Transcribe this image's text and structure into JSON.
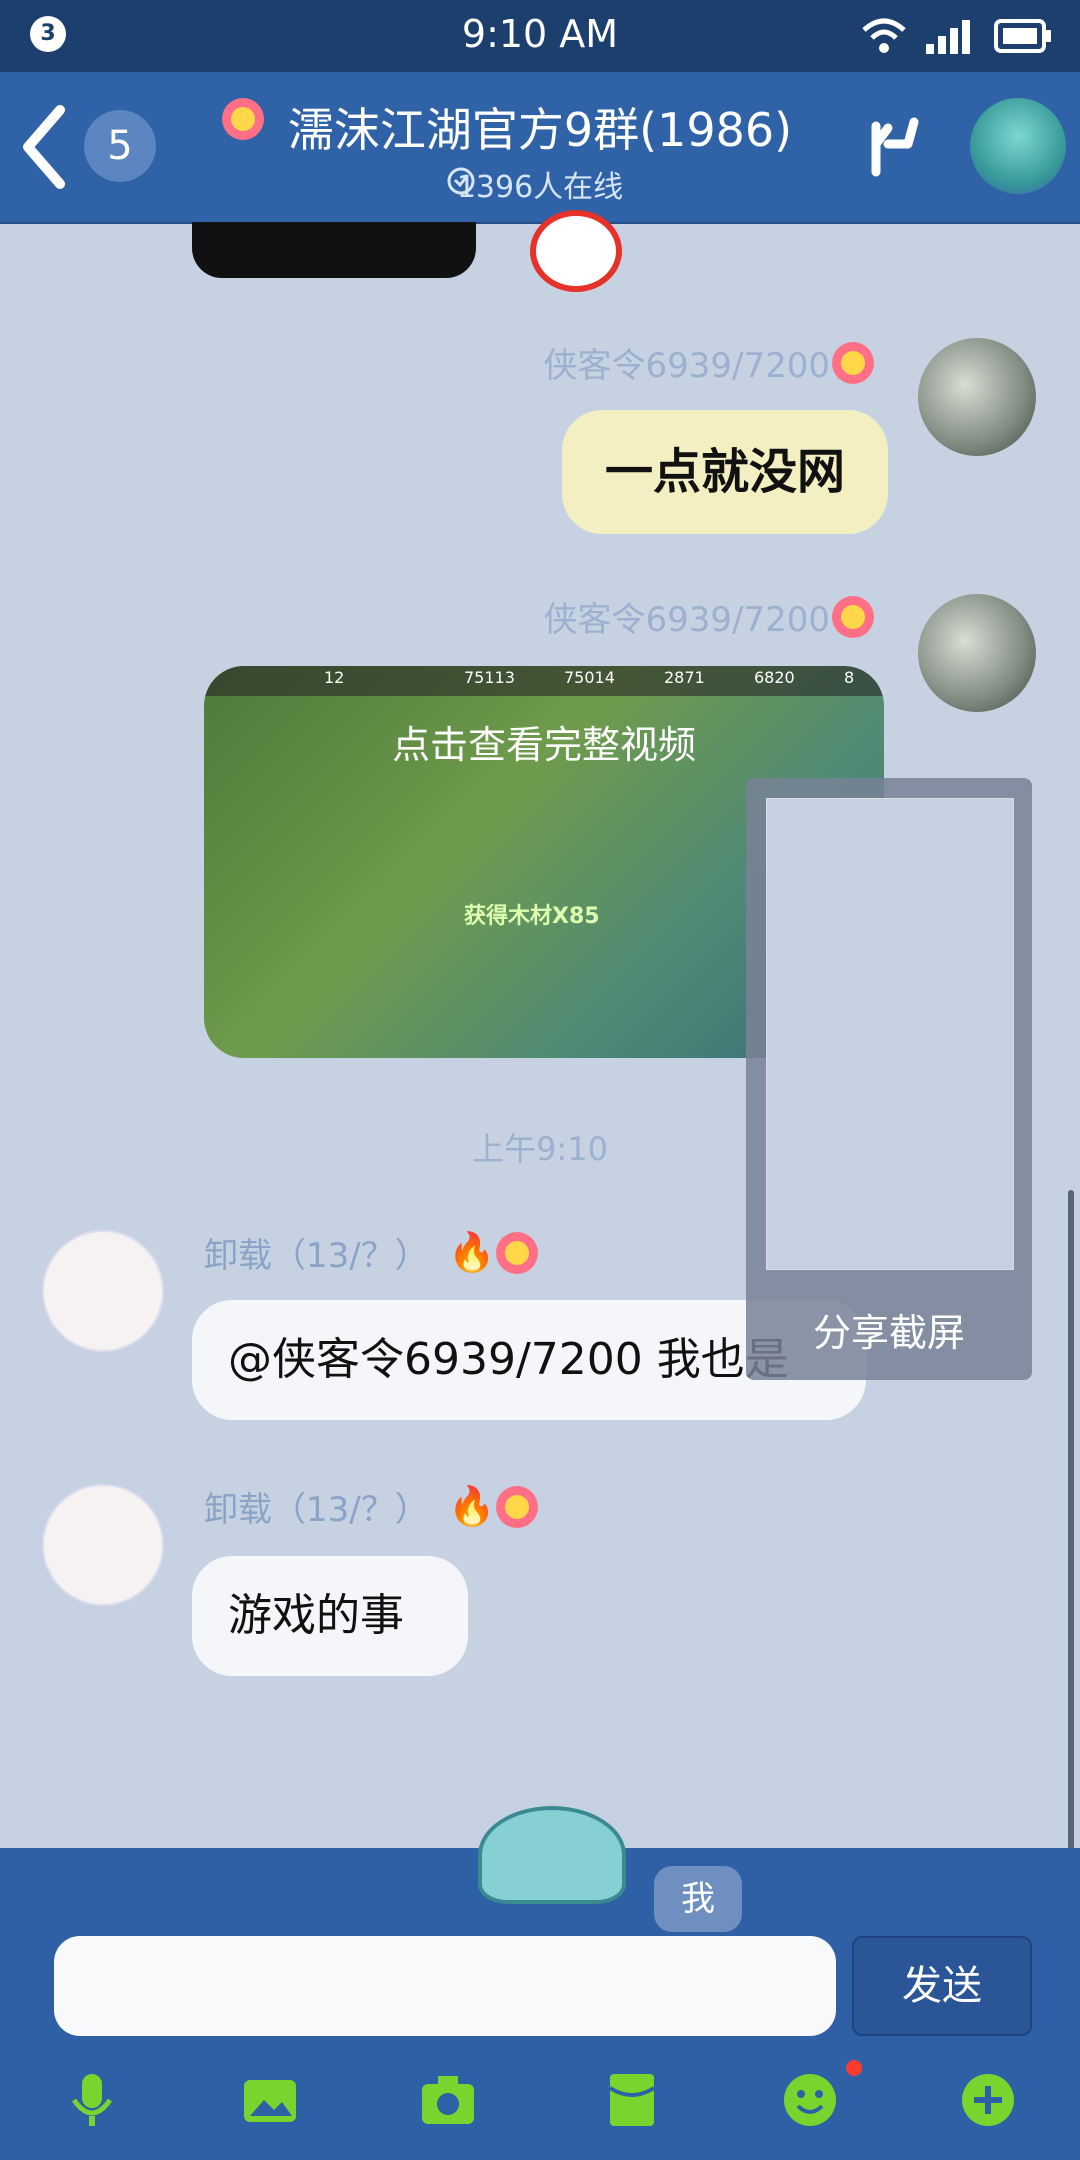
{
  "status_bar": {
    "notification_count": "3",
    "time": "9:10 AM"
  },
  "header": {
    "unread_count": "5",
    "title": "濡沫江湖官方9群(1986)",
    "online": "1396人在线"
  },
  "messages": [
    {
      "sender": "侠客令6939/7200",
      "text": "一点就没网"
    },
    {
      "sender": "侠客令6939/7200",
      "video_caption": "点击查看完整视频",
      "video_stats": [
        "12",
        "75113",
        "75014",
        "2871",
        "6820",
        "8"
      ],
      "video_reward": "获得木材X85"
    },
    {
      "time": "上午9:10"
    },
    {
      "sender": "卸载（13/？）",
      "text": "@侠客令6939/7200 我也是"
    },
    {
      "sender": "卸载（13/？）",
      "text": "游戏的事"
    }
  ],
  "screenshot_overlay": {
    "label": "分享截屏"
  },
  "input": {
    "me_label": "我",
    "send_label": "发送"
  },
  "colors": {
    "header": "#2f62a6",
    "chat_bg": "#c6d2e2",
    "bubble_self": "#f3efc2",
    "bubble_other": "#f4f6fa"
  }
}
